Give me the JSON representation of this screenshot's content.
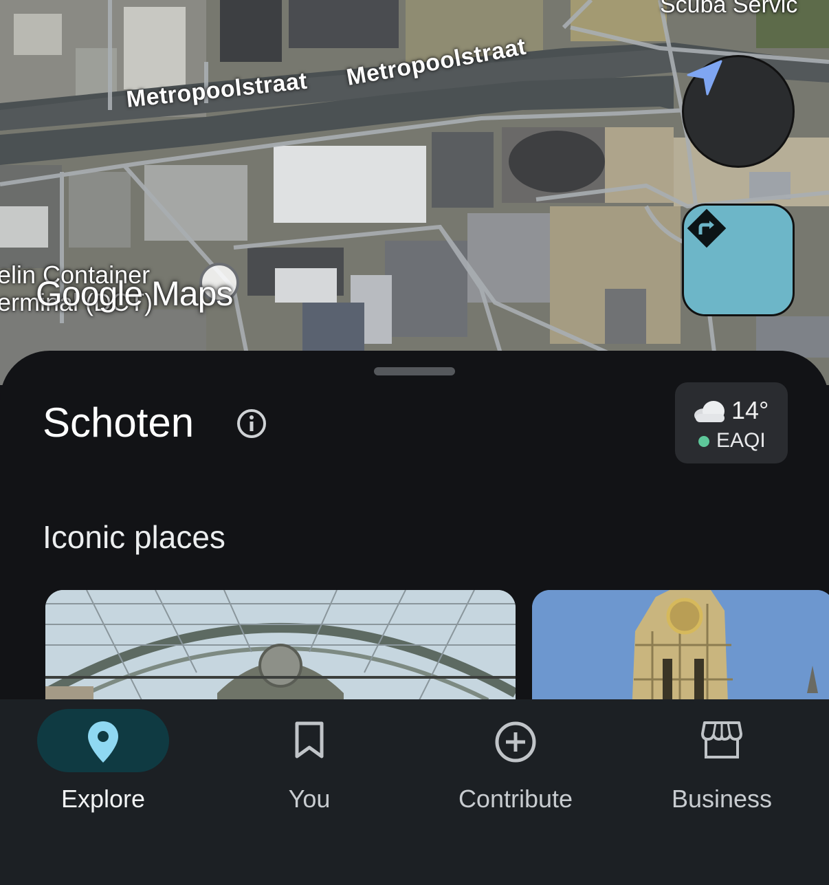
{
  "map": {
    "street_labels": [
      "Metropoolstraat",
      "Metropoolstraat"
    ],
    "poi_label_line1": "elin Container",
    "poi_label_line2": "erminal (DCT)",
    "corner_label": "Scuba Servic",
    "watermark": "Google Maps"
  },
  "place": {
    "title": "Schoten"
  },
  "weather": {
    "temperature": "14°",
    "air_quality_label": "EAQI",
    "air_quality_color": "#5ec79a",
    "icon": "cloud-icon"
  },
  "section": {
    "title": "Iconic places"
  },
  "nav": {
    "items": [
      {
        "label": "Explore",
        "icon": "location-pin-icon",
        "active": true
      },
      {
        "label": "You",
        "icon": "bookmark-icon",
        "active": false
      },
      {
        "label": "Contribute",
        "icon": "add-circle-icon",
        "active": false
      },
      {
        "label": "Business",
        "icon": "storefront-icon",
        "active": false
      }
    ]
  },
  "colors": {
    "accent": "#8fd8f2",
    "directions_button": "#6db6c8",
    "active_pill": "#0f3a42",
    "location_arrow": "#7fa6f2"
  }
}
